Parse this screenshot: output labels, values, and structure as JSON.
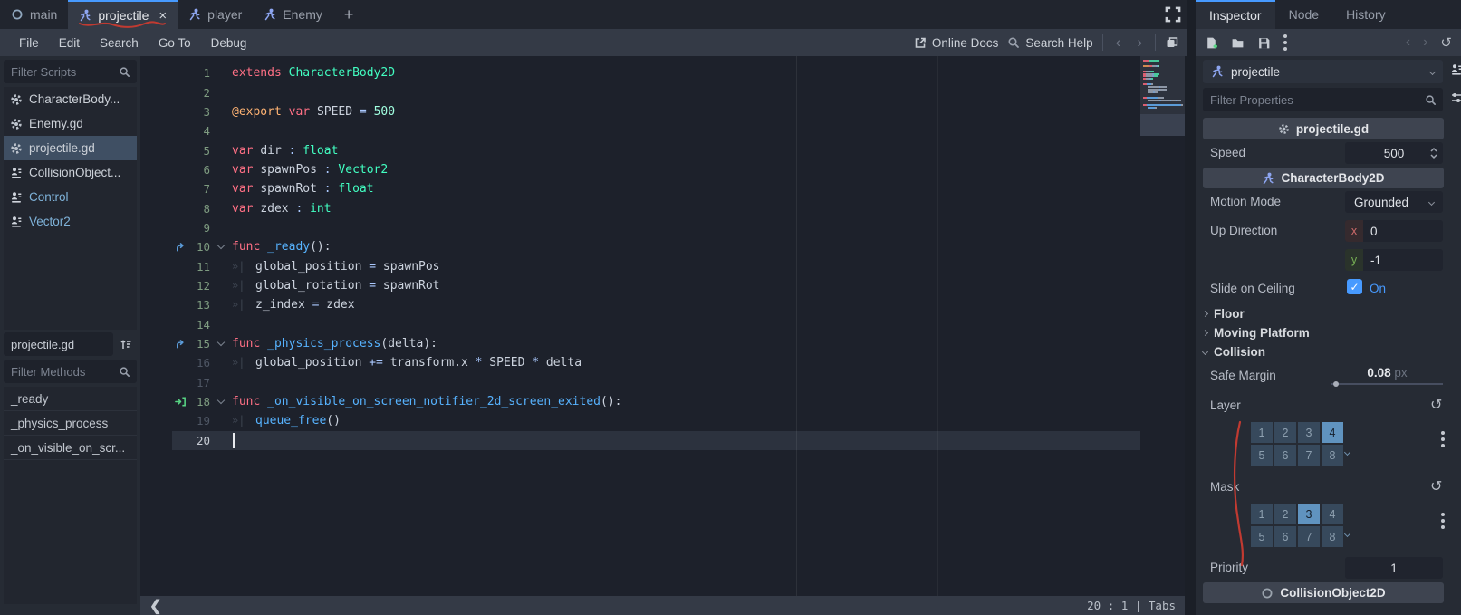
{
  "accent_color": "#479aff",
  "annotation_color": "#c13a31",
  "script_tabs": {
    "tabs": [
      {
        "label": "main",
        "icon": "scene-circle-icon",
        "active": false
      },
      {
        "label": "projectile",
        "icon": "character-body-icon",
        "active": true,
        "closable": true,
        "annotated": true
      },
      {
        "label": "player",
        "icon": "character-body-icon",
        "active": false
      },
      {
        "label": "Enemy",
        "icon": "character-body-icon",
        "active": false
      }
    ],
    "add_label": "+"
  },
  "menu": {
    "items": [
      "File",
      "Edit",
      "Search",
      "Go To",
      "Debug"
    ],
    "online_docs": "Online Docs",
    "search_help": "Search Help",
    "back": "‹",
    "forward": "›"
  },
  "scripts_panel": {
    "filter_placeholder": "Filter Scripts",
    "items": [
      {
        "label": "CharacterBody...",
        "icon": "gear-icon",
        "selected": false,
        "blue": false
      },
      {
        "label": "Enemy.gd",
        "icon": "gear-icon",
        "selected": false,
        "blue": false
      },
      {
        "label": "projectile.gd",
        "icon": "gear-icon",
        "selected": true,
        "blue": false
      },
      {
        "label": "CollisionObject...",
        "icon": "class-doc-icon",
        "selected": false,
        "blue": false
      },
      {
        "label": "Control",
        "icon": "class-doc-icon",
        "selected": false,
        "blue": true
      },
      {
        "label": "Vector2",
        "icon": "class-doc-icon",
        "selected": false,
        "blue": true
      }
    ],
    "current_script": "projectile.gd",
    "methods_filter_placeholder": "Filter Methods",
    "methods": [
      "_ready",
      "_physics_process",
      "_on_visible_on_scr..."
    ]
  },
  "editor": {
    "lines": [
      {
        "n": 1,
        "safe": true,
        "tokens": [
          [
            "kw",
            "extends "
          ],
          [
            "cls",
            "CharacterBody2D"
          ]
        ]
      },
      {
        "n": 2,
        "safe": true,
        "tokens": []
      },
      {
        "n": 3,
        "safe": true,
        "tokens": [
          [
            "ann",
            "@export "
          ],
          [
            "kw",
            "var "
          ],
          [
            "txt",
            "SPEED "
          ],
          [
            "op",
            "= "
          ],
          [
            "num",
            "500"
          ]
        ]
      },
      {
        "n": 4,
        "safe": true,
        "tokens": []
      },
      {
        "n": 5,
        "safe": true,
        "tokens": [
          [
            "kw",
            "var "
          ],
          [
            "txt",
            "dir "
          ],
          [
            "op",
            ": "
          ],
          [
            "cls",
            "float"
          ]
        ]
      },
      {
        "n": 6,
        "safe": true,
        "tokens": [
          [
            "kw",
            "var "
          ],
          [
            "txt",
            "spawnPos "
          ],
          [
            "op",
            ": "
          ],
          [
            "cls",
            "Vector2"
          ]
        ]
      },
      {
        "n": 7,
        "safe": true,
        "tokens": [
          [
            "kw",
            "var "
          ],
          [
            "txt",
            "spawnRot "
          ],
          [
            "op",
            ": "
          ],
          [
            "cls",
            "float"
          ]
        ]
      },
      {
        "n": 8,
        "safe": true,
        "tokens": [
          [
            "kw",
            "var "
          ],
          [
            "txt",
            "zdex "
          ],
          [
            "op",
            ": "
          ],
          [
            "cls",
            "int"
          ]
        ]
      },
      {
        "n": 9,
        "safe": true,
        "tokens": []
      },
      {
        "n": 10,
        "safe": true,
        "icon": "override",
        "fold": true,
        "tokens": [
          [
            "kw",
            "func "
          ],
          [
            "fn",
            "_ready"
          ],
          [
            "txt",
            "():"
          ]
        ]
      },
      {
        "n": 11,
        "safe": true,
        "indent": 1,
        "tokens": [
          [
            "txt",
            "global_position "
          ],
          [
            "op",
            "= "
          ],
          [
            "txt",
            "spawnPos"
          ]
        ]
      },
      {
        "n": 12,
        "safe": true,
        "indent": 1,
        "tokens": [
          [
            "txt",
            "global_rotation "
          ],
          [
            "op",
            "= "
          ],
          [
            "txt",
            "spawnRot"
          ]
        ]
      },
      {
        "n": 13,
        "safe": true,
        "indent": 1,
        "tokens": [
          [
            "txt",
            "z_index "
          ],
          [
            "op",
            "= "
          ],
          [
            "txt",
            "zdex"
          ]
        ]
      },
      {
        "n": 14,
        "safe": true,
        "tokens": []
      },
      {
        "n": 15,
        "safe": true,
        "icon": "override",
        "fold": true,
        "tokens": [
          [
            "kw",
            "func "
          ],
          [
            "fn",
            "_physics_process"
          ],
          [
            "txt",
            "(delta):"
          ]
        ]
      },
      {
        "n": 16,
        "safe": false,
        "indent": 1,
        "tokens": [
          [
            "txt",
            "global_position "
          ],
          [
            "op",
            "+= "
          ],
          [
            "txt",
            "transform.x "
          ],
          [
            "op",
            "* "
          ],
          [
            "txt",
            "SPEED "
          ],
          [
            "op",
            "* "
          ],
          [
            "txt",
            "delta"
          ]
        ]
      },
      {
        "n": 17,
        "safe": false,
        "tokens": []
      },
      {
        "n": 18,
        "safe": true,
        "icon": "connect",
        "fold": true,
        "tokens": [
          [
            "kw",
            "func "
          ],
          [
            "fn",
            "_on_visible_on_screen_notifier_2d_screen_exited"
          ],
          [
            "txt",
            "():"
          ]
        ]
      },
      {
        "n": 19,
        "safe": false,
        "indent": 1,
        "tokens": [
          [
            "fn",
            "queue_free"
          ],
          [
            "txt",
            "()"
          ]
        ]
      },
      {
        "n": 20,
        "safe": false,
        "current": true,
        "tokens": []
      }
    ],
    "status": {
      "text": "20 :   1 | Tabs",
      "collapse": "❮"
    }
  },
  "inspector": {
    "tabs": [
      {
        "label": "Inspector",
        "active": true
      },
      {
        "label": "Node",
        "active": false
      },
      {
        "label": "History",
        "active": false
      }
    ],
    "object_name": "projectile",
    "filter_placeholder": "Filter Properties",
    "script_category": "projectile.gd",
    "class_category": "CharacterBody2D",
    "bottom_category": "CollisionObject2D",
    "rows": {
      "speed": {
        "label": "Speed",
        "value": "500"
      },
      "motion_mode": {
        "label": "Motion Mode",
        "value": "Grounded"
      },
      "up_direction": {
        "label": "Up Direction",
        "x_label": "x",
        "x_value": "0",
        "y_label": "y",
        "y_value": "-1"
      },
      "slide_on_ceiling": {
        "label": "Slide on Ceiling",
        "value": "On",
        "checked": true,
        "check_glyph": "✓"
      },
      "safe_margin": {
        "label": "Safe Margin",
        "value": "0.08",
        "suffix": "px"
      },
      "priority": {
        "label": "Priority",
        "value": "1"
      }
    },
    "groups": [
      {
        "label": "Floor",
        "expanded": false
      },
      {
        "label": "Moving Platform",
        "expanded": false
      },
      {
        "label": "Collision",
        "expanded": true
      }
    ],
    "layer": {
      "label": "Layer",
      "cells": [
        "1",
        "2",
        "3",
        "4",
        "5",
        "6",
        "7",
        "8"
      ],
      "active": [
        "4"
      ],
      "revert_glyph": "↺"
    },
    "mask": {
      "label": "Mask",
      "cells": [
        "1",
        "2",
        "3",
        "4",
        "5",
        "6",
        "7",
        "8"
      ],
      "active": [
        "3"
      ],
      "revert_glyph": "↺"
    }
  }
}
